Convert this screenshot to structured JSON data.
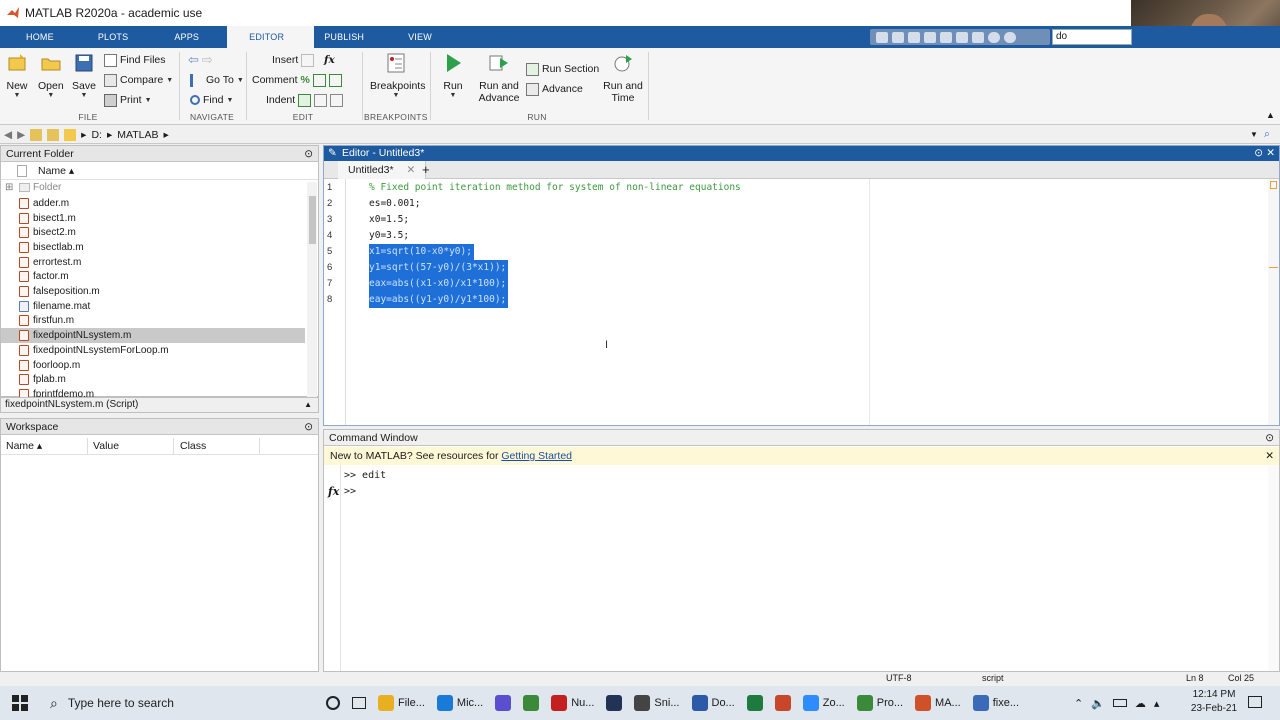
{
  "window": {
    "title": "MATLAB R2020a - academic use"
  },
  "tabs": [
    {
      "label": "HOME"
    },
    {
      "label": "PLOTS"
    },
    {
      "label": "APPS"
    },
    {
      "label": "EDITOR"
    },
    {
      "label": "PUBLISH"
    },
    {
      "label": "VIEW"
    }
  ],
  "search": {
    "value": "do"
  },
  "ribbon": {
    "file": {
      "label": "FILE",
      "new": "New",
      "open": "Open",
      "save": "Save",
      "find_files": "Find Files",
      "compare": "Compare",
      "print": "Print"
    },
    "navigate": {
      "label": "NAVIGATE",
      "go_to": "Go To",
      "find": "Find"
    },
    "edit": {
      "label": "EDIT",
      "insert": "Insert",
      "comment": "Comment",
      "indent": "Indent",
      "fx": "fx"
    },
    "breakpoints": {
      "label": "BREAKPOINTS",
      "breakpoints": "Breakpoints"
    },
    "run": {
      "label": "RUN",
      "run": "Run",
      "run_advance_1": "Run and",
      "run_advance_2": "Advance",
      "run_section": "Run Section",
      "advance": "Advance",
      "run_time_1": "Run and",
      "run_time_2": "Time"
    }
  },
  "address": {
    "drive": "D:",
    "folder": "MATLAB"
  },
  "current_folder": {
    "title": "Current Folder",
    "column": "Name ▴",
    "folder_label": "Folder",
    "files": [
      "adder.m",
      "bisect1.m",
      "bisect2.m",
      "bisectlab.m",
      "errortest.m",
      "factor.m",
      "falseposition.m",
      "filename.mat",
      "firstfun.m",
      "fixedpointNLsystem.m",
      "fixedpointNLsystemForLoop.m",
      "foorloop.m",
      "fplab.m",
      "fprintfdemo.m"
    ],
    "selected": "fixedpointNLsystem.m",
    "details": "fixedpointNLsystem.m  (Script)"
  },
  "workspace": {
    "title": "Workspace",
    "columns": [
      "Name ▴",
      "Value",
      "Class"
    ]
  },
  "editor": {
    "title": "Editor - Untitled3*",
    "tab": "Untitled3*",
    "lines": [
      {
        "n": "1",
        "text": "% Fixed point iteration method for system of non-linear equations",
        "kind": "comment"
      },
      {
        "n": "2",
        "text": "es=0.001;",
        "kind": "code"
      },
      {
        "n": "3",
        "text": "x0=1.5;",
        "kind": "code"
      },
      {
        "n": "4",
        "text": "y0=3.5;",
        "kind": "code"
      },
      {
        "n": "5",
        "text": "x1=sqrt(10-x0*y0);",
        "kind": "selected"
      },
      {
        "n": "6",
        "text": "y1=sqrt((57-y0)/(3*x1));",
        "kind": "selected"
      },
      {
        "n": "7",
        "text": "eax=abs((x1-x0)/x1*100);",
        "kind": "selected"
      },
      {
        "n": "8",
        "text": "eay=abs((y1-y0)/y1*100);",
        "kind": "selected"
      }
    ]
  },
  "command_window": {
    "title": "Command Window",
    "banner_text": "New to MATLAB? See resources for ",
    "banner_link": "Getting Started",
    "history": ">> edit",
    "prompt": ">>",
    "fx": "fx"
  },
  "status": {
    "encoding": "UTF-8",
    "type": "script",
    "ln": "Ln  8",
    "col": "Col  25"
  },
  "taskbar": {
    "search_placeholder": "Type here to search",
    "apps": [
      {
        "label": "File...",
        "color": "#e8b020"
      },
      {
        "label": "Mic...",
        "color": "#1a7ad8"
      },
      {
        "label": "",
        "color": "#5a4fcf"
      },
      {
        "label": "",
        "color": "#3a8a3a"
      },
      {
        "label": "Nu...",
        "color": "#c42020"
      },
      {
        "label": "",
        "color": "#223355"
      },
      {
        "label": "Sni...",
        "color": "#444444"
      },
      {
        "label": "Do...",
        "color": "#2a5aa8"
      },
      {
        "label": "",
        "color": "#1e7a3e"
      },
      {
        "label": "",
        "color": "#c8462a"
      },
      {
        "label": "Zo...",
        "color": "#2d8cff"
      },
      {
        "label": "Pro...",
        "color": "#3a8a3a"
      },
      {
        "label": "MA...",
        "color": "#d0502a"
      },
      {
        "label": "fixe...",
        "color": "#3a6ab8"
      }
    ],
    "time": "12:14 PM",
    "date": "23-Feb-21"
  }
}
